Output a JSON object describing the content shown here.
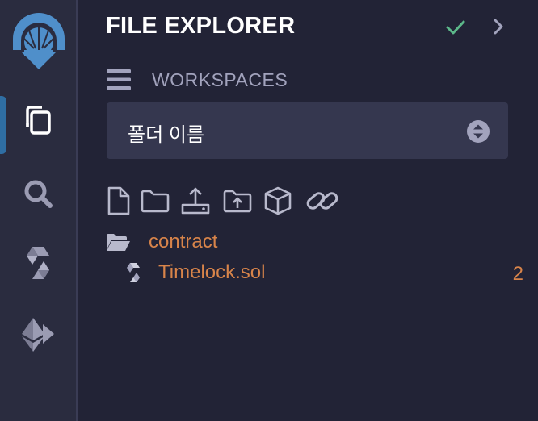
{
  "panel": {
    "title": "FILE EXPLORER"
  },
  "workspaces": {
    "label": "WORKSPACES",
    "selected": "폴더 이름"
  },
  "tree": {
    "folder": {
      "name": "contract"
    },
    "file": {
      "name": "Timelock.sol",
      "badge": "2"
    }
  },
  "icons": {
    "rail": [
      "remix-logo-icon",
      "file-explorer-icon",
      "search-icon",
      "solidity-compiler-icon",
      "deploy-run-icon"
    ],
    "toolbar": [
      "new-file-icon",
      "new-folder-icon",
      "publish-gist-icon",
      "upload-file-icon",
      "box-icon",
      "link-icon"
    ]
  },
  "colors": {
    "background": "#222336",
    "rail": "#2a2c3f",
    "accent": "#2f6ea3",
    "file_text": "#d8844a",
    "success": "#5cb88a",
    "muted": "#a2a3bd"
  }
}
